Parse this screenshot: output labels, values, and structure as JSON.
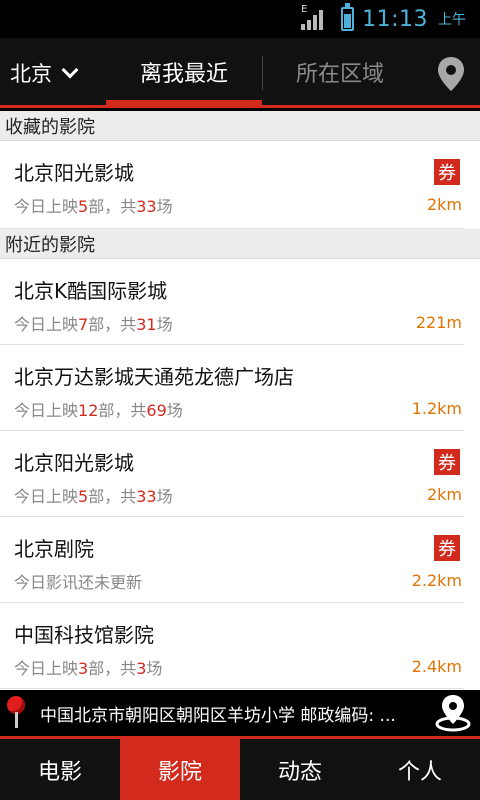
{
  "status_bar": {
    "time": "11:13",
    "ampm": "上午",
    "network": "E",
    "battery_level": 0.7
  },
  "top_nav": {
    "city": "北京",
    "tabs": [
      {
        "label": "离我最近",
        "active": true
      },
      {
        "label": "所在区域",
        "active": false
      }
    ]
  },
  "sections": {
    "favorites_title": "收藏的影院",
    "nearby_title": "附近的影院"
  },
  "favorites": [
    {
      "name": "北京阳光影城",
      "info_prefix": "今日上映",
      "movies": "5",
      "info_mid": "部，共",
      "shows": "33",
      "info_suffix": "场",
      "distance": "2km",
      "coupon": "券"
    }
  ],
  "nearby": [
    {
      "name": "北京K酷国际影城",
      "info_prefix": "今日上映",
      "movies": "7",
      "info_mid": "部，共",
      "shows": "31",
      "info_suffix": "场",
      "distance": "221m"
    },
    {
      "name": "北京万达影城天通苑龙德广场店",
      "info_prefix": "今日上映",
      "movies": "12",
      "info_mid": "部，共",
      "shows": "69",
      "info_suffix": "场",
      "distance": "1.2km"
    },
    {
      "name": "北京阳光影城",
      "info_prefix": "今日上映",
      "movies": "5",
      "info_mid": "部，共",
      "shows": "33",
      "info_suffix": "场",
      "distance": "2km",
      "coupon": "券"
    },
    {
      "name": "北京剧院",
      "info_text": "今日影讯还未更新",
      "distance": "2.2km",
      "coupon": "券"
    },
    {
      "name": "中国科技馆影院",
      "info_prefix": "今日上映",
      "movies": "3",
      "info_mid": "部，共",
      "shows": "3",
      "info_suffix": "场",
      "distance": "2.4km"
    }
  ],
  "location_bar": {
    "text": "中国北京市朝阳区朝阳区羊坊小学 邮政编码: ..."
  },
  "bottom_tabs": [
    {
      "label": "电影",
      "active": false
    },
    {
      "label": "影院",
      "active": true
    },
    {
      "label": "动态",
      "active": false
    },
    {
      "label": "个人",
      "active": false
    }
  ],
  "colors": {
    "accent": "#d32a1e",
    "distance": "#e07400",
    "status": "#4fb3d9"
  },
  "icons": {
    "location": "location-pin-icon",
    "gps": "gps-locate-icon",
    "dropdown": "chevron-down-icon"
  }
}
